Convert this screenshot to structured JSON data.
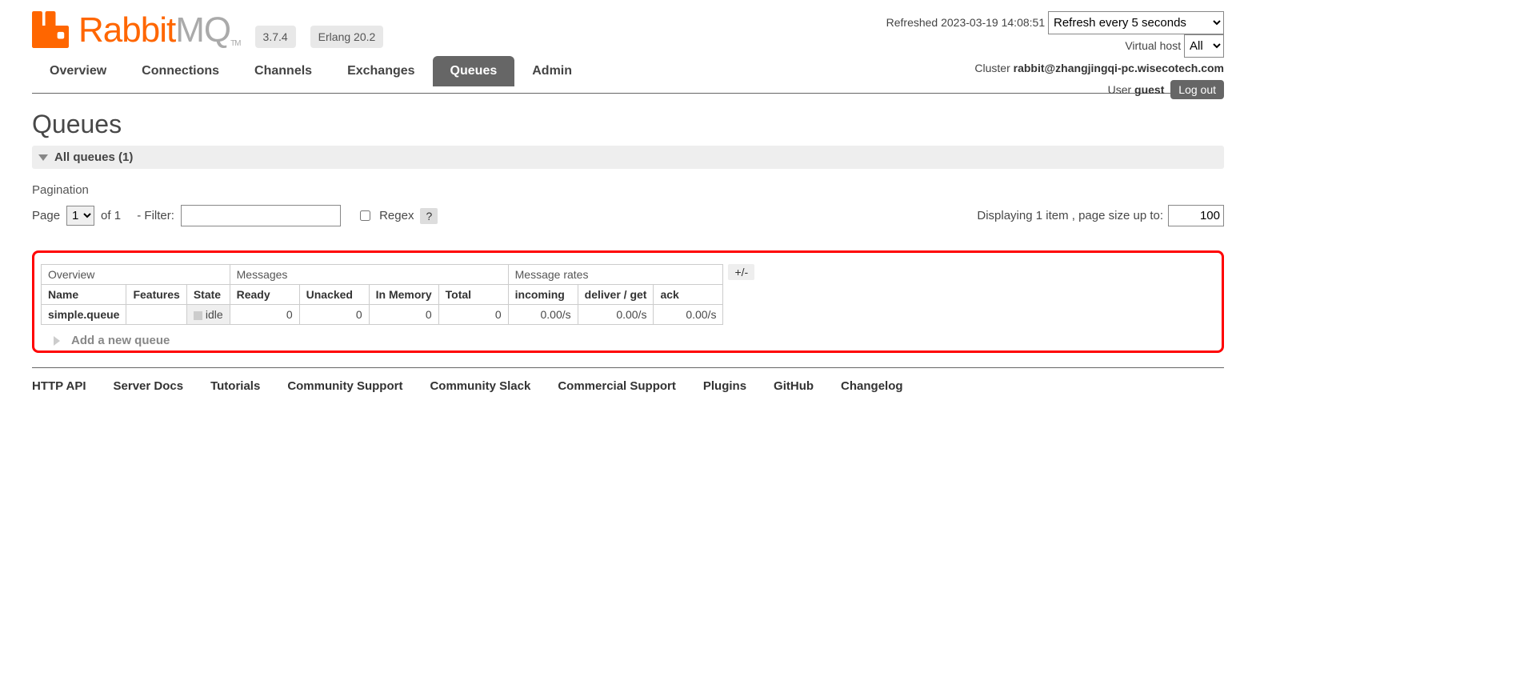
{
  "header": {
    "brand_prefix": "Rabbit",
    "brand_suffix": "MQ",
    "tm": "TM",
    "version": "3.7.4",
    "erlang": "Erlang 20.2",
    "refreshed_label": "Refreshed 2023-03-19 14:08:51",
    "refresh_selected": "Refresh every 5 seconds",
    "vhost_label": "Virtual host",
    "vhost_selected": "All",
    "cluster_label": "Cluster",
    "cluster_value": "rabbit@zhangjingqi-pc.wisecotech.com",
    "user_label": "User",
    "user_value": "guest",
    "logout": "Log out"
  },
  "tabs": {
    "overview": "Overview",
    "connections": "Connections",
    "channels": "Channels",
    "exchanges": "Exchanges",
    "queues": "Queues",
    "admin": "Admin"
  },
  "page": {
    "title": "Queues",
    "section_all": "All queues (1)",
    "pagination_label": "Pagination",
    "page_label": "Page",
    "page_selected": "1",
    "of_label": "of 1",
    "filter_label": "- Filter:",
    "filter_value": "",
    "regex_label": "Regex",
    "regex_help": "?",
    "displaying": "Displaying 1 item , page size up to:",
    "page_size": "100",
    "plus_minus": "+/-",
    "add_queue": "Add a new queue"
  },
  "table": {
    "groups": {
      "overview": "Overview",
      "messages": "Messages",
      "rates": "Message rates"
    },
    "headers": {
      "name": "Name",
      "features": "Features",
      "state": "State",
      "ready": "Ready",
      "unacked": "Unacked",
      "in_memory": "In Memory",
      "total": "Total",
      "incoming": "incoming",
      "deliver_get": "deliver / get",
      "ack": "ack"
    },
    "row": {
      "name": "simple.queue",
      "features": "",
      "state": "idle",
      "ready": "0",
      "unacked": "0",
      "in_memory": "0",
      "total": "0",
      "incoming": "0.00/s",
      "deliver_get": "0.00/s",
      "ack": "0.00/s"
    }
  },
  "footer": {
    "http_api": "HTTP API",
    "server_docs": "Server Docs",
    "tutorials": "Tutorials",
    "community_support": "Community Support",
    "community_slack": "Community Slack",
    "commercial_support": "Commercial Support",
    "plugins": "Plugins",
    "github": "GitHub",
    "changelog": "Changelog"
  }
}
